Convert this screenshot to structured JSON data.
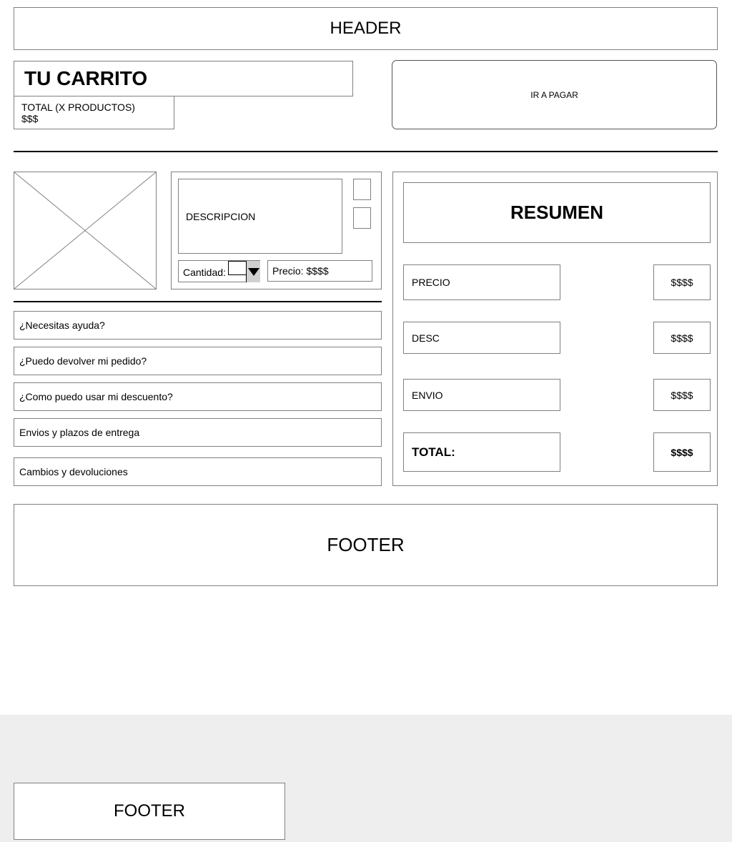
{
  "header": {
    "label": "HEADER"
  },
  "cart": {
    "title": "TU CARRITO",
    "total_line": "TOTAL (X PRODUCTOS)",
    "total_value": "$$$",
    "pay_label": "IR A PAGAR"
  },
  "item": {
    "description": "DESCRIPCION",
    "quantity_label": "Cantidad:",
    "price_text": "Precio: $$$$"
  },
  "faq": [
    "¿Necesitas ayuda?",
    "¿Puedo devolver mi pedido?",
    "¿Como puedo usar mi descuento?",
    "Envios y plazos de entrega",
    "Cambios y devoluciones"
  ],
  "summary": {
    "title": "RESUMEN",
    "rows": [
      {
        "label": "PRECIO",
        "value": "$$$$"
      },
      {
        "label": "DESC",
        "value": "$$$$"
      },
      {
        "label": "ENVIO",
        "value": "$$$$"
      },
      {
        "label": "TOTAL:",
        "value": "$$$$"
      }
    ]
  },
  "footer": {
    "label": "FOOTER",
    "mobile_label": "FOOTER"
  }
}
